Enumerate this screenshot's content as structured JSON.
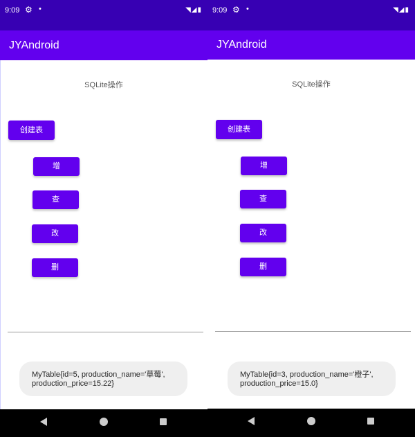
{
  "left": {
    "status": {
      "time": "9:09",
      "gear": "⚙",
      "dot": "•",
      "sys": "◥◢▮"
    },
    "appbar_title": "JYAndroid",
    "heading": "SQLite操作",
    "buttons": {
      "create": "创建表",
      "add": "增",
      "query": "查",
      "update": "改",
      "delete": "删"
    },
    "toast": "MyTable{id=5, production_name='草莓', production_price=15.22}"
  },
  "right": {
    "status": {
      "time": "9:09",
      "gear": "⚙",
      "dot": "•",
      "sys": "◥◢▮"
    },
    "appbar_title": "JYAndroid",
    "heading": "SQLite操作",
    "buttons": {
      "create": "创建表",
      "add": "增",
      "query": "查",
      "update": "改",
      "delete": "删"
    },
    "toast": "MyTable{id=3, production_name='橙子', production_price=15.0}"
  },
  "colors": {
    "status_bar": "#3700b3",
    "app_bar": "#6200ee",
    "button": "#6200ee",
    "toast_bg": "#efefef"
  }
}
